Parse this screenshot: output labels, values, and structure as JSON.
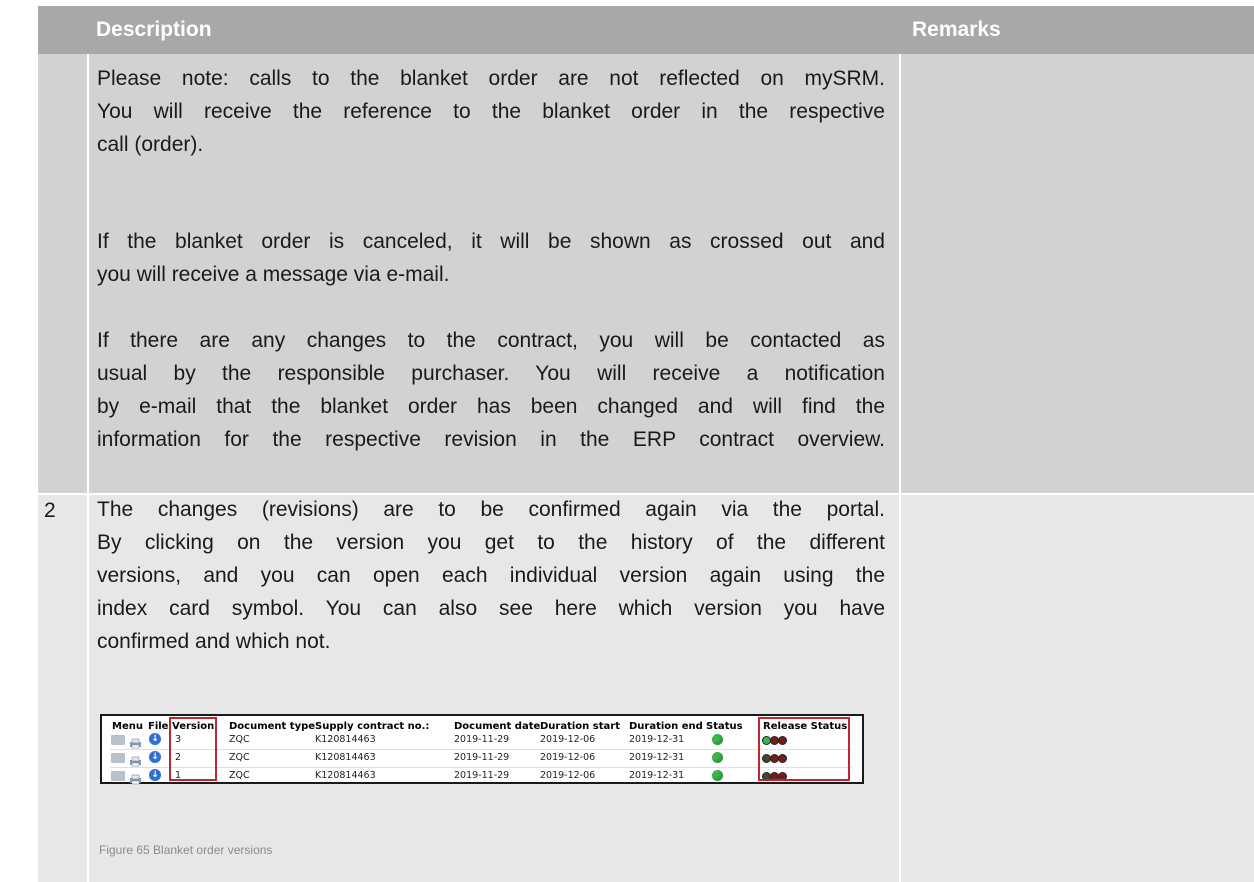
{
  "header": {
    "description": "Description",
    "remarks": "Remarks"
  },
  "row1": {
    "number": "",
    "paragraphs": [
      [
        "Please note: calls to the blanket order are not reflected on mySRM.",
        "You will receive the reference to the blanket order in the respective",
        "call (order)."
      ],
      [
        "If the blanket order is canceled, it will be shown as crossed out and",
        "you will receive a message via e-mail."
      ],
      [
        "If there are any changes to the contract, you will be contacted as",
        "usual by the responsible purchaser. You will receive a notification",
        "by e-mail that the blanket order has been changed and will find the",
        "information for the respective revision in the ERP contract overview."
      ]
    ]
  },
  "row2": {
    "number": "2",
    "lines": [
      "The changes (revisions) are to be confirmed again via the portal.",
      "By clicking on the version you get to the history of the different",
      "versions, and you can open each individual version again using the",
      "index card symbol. You can also see here which version you have",
      "confirmed and which not."
    ],
    "figure": {
      "columns": [
        "Menu",
        "File",
        "Version",
        "Document type",
        "Supply contract no.:",
        "Document date",
        "Duration start",
        "Duration end",
        "Status",
        "Release Status"
      ],
      "rows": [
        {
          "version": "3",
          "doc_type": "ZQC",
          "contract": "K120814463",
          "doc_date": "2019-11-29",
          "start": "2019-12-06",
          "end": "2019-12-31",
          "status": "green",
          "release": [
            "#3cb54a",
            "#7a1a1a",
            "#7a1a1a"
          ]
        },
        {
          "version": "2",
          "doc_type": "ZQC",
          "contract": "K120814463",
          "doc_date": "2019-11-29",
          "start": "2019-12-06",
          "end": "2019-12-31",
          "status": "green",
          "release": [
            "#3a4a2a",
            "#7a1a1a",
            "#7a1a1a"
          ]
        },
        {
          "version": "1",
          "doc_type": "ZQC",
          "contract": "K120814463",
          "doc_date": "2019-11-29",
          "start": "2019-12-06",
          "end": "2019-12-31",
          "status": "green",
          "release": [
            "#3a4a2a",
            "#7a1a1a",
            "#7a1a1a"
          ]
        }
      ],
      "caption": "Figure 65 Blanket order versions"
    }
  }
}
